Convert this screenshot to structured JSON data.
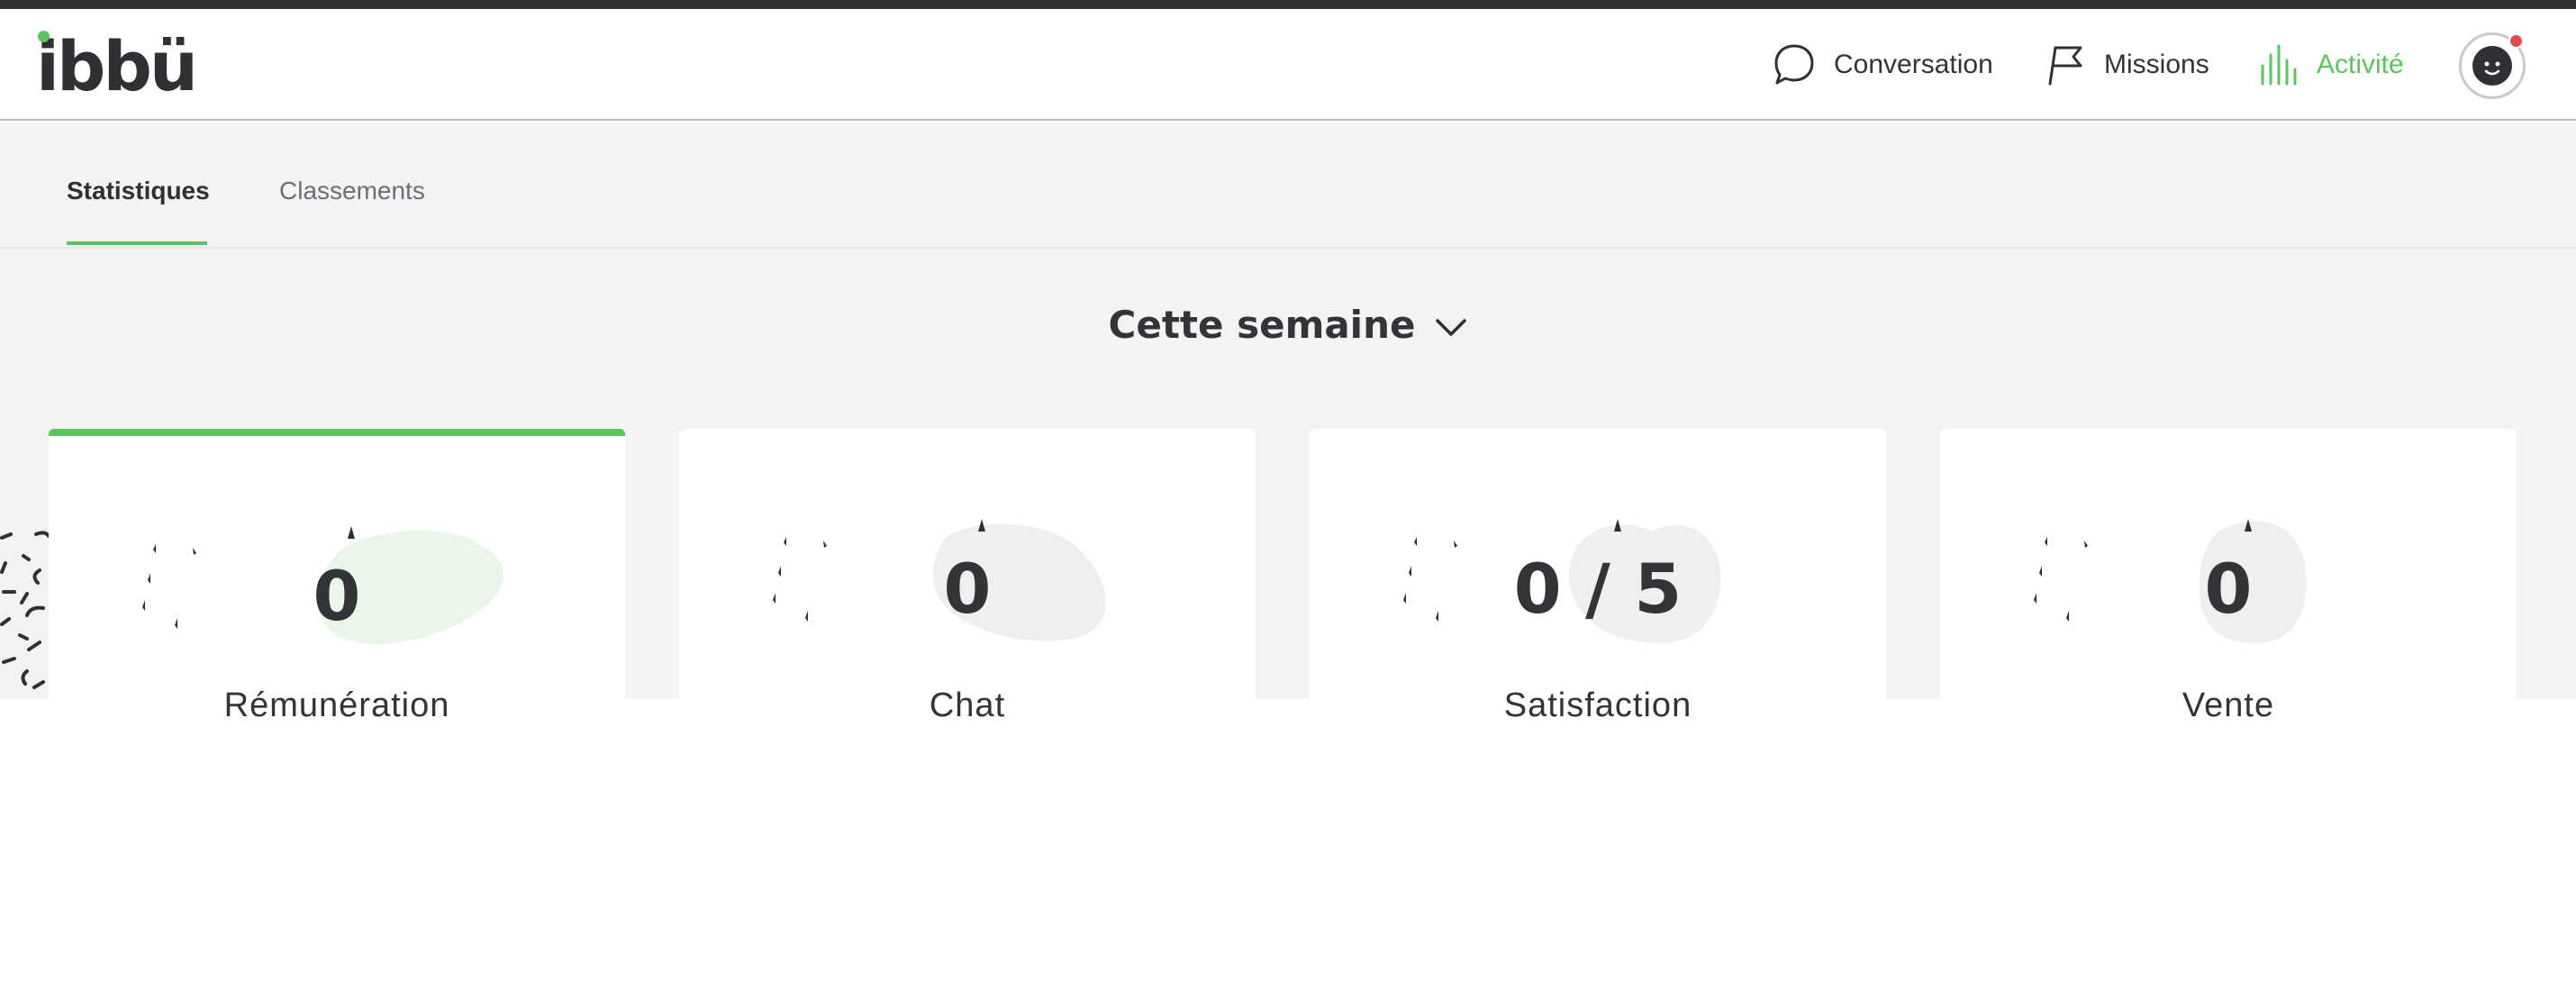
{
  "header": {
    "logo_text": "ibbü",
    "nav": [
      {
        "label": "Conversation",
        "icon": "chat-bubble-icon"
      },
      {
        "label": "Missions",
        "icon": "flag-icon"
      },
      {
        "label": "Activité",
        "icon": "bar-chart-icon",
        "active": true
      }
    ],
    "avatar_badge_color": "#e5484d"
  },
  "tabs": [
    {
      "label": "Statistiques",
      "active": true
    },
    {
      "label": "Classements",
      "active": false
    }
  ],
  "period": {
    "label": "Cette semaine",
    "icon": "chevron-down-icon"
  },
  "stats": [
    {
      "value": "0",
      "label": "Rémunération",
      "selected": true
    },
    {
      "value": "0",
      "label": "Chat",
      "selected": false
    },
    {
      "value": "0 / 5",
      "label": "Satisfaction",
      "selected": false
    },
    {
      "value": "0",
      "label": "Vente",
      "selected": false
    }
  ],
  "colors": {
    "accent": "#5cc45f",
    "text": "#333438",
    "muted": "#6b6e78",
    "background": "#f3f3f3"
  }
}
